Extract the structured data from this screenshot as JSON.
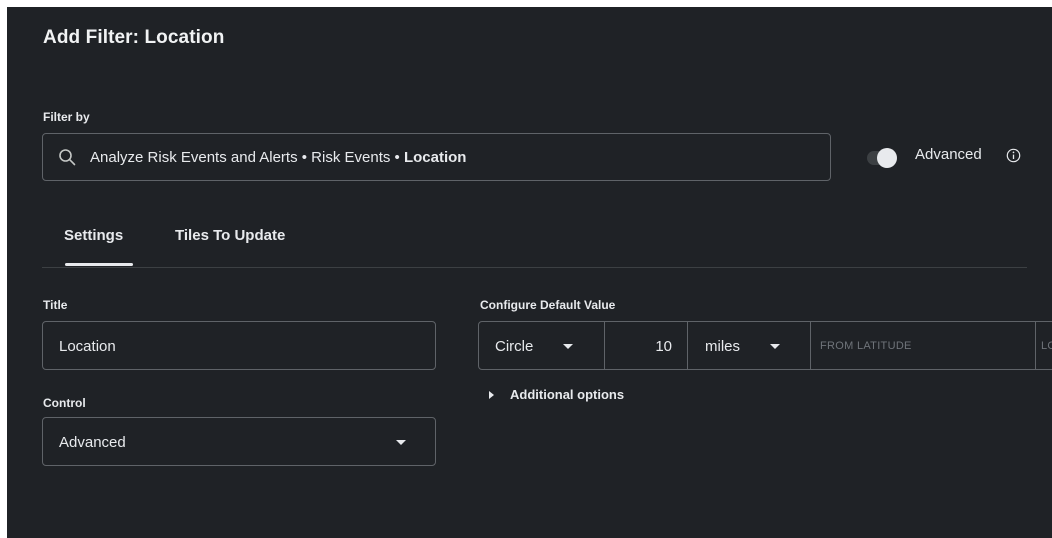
{
  "dialog": {
    "title": "Add Filter: Location"
  },
  "filter_by": {
    "label": "Filter by",
    "path_prefix": "Analyze Risk Events and Alerts • Risk Events • ",
    "path_field": "Location",
    "advanced_toggle_label": "Advanced",
    "advanced_enabled": false
  },
  "tabs": [
    {
      "label": "Settings",
      "active": true
    },
    {
      "label": "Tiles To Update",
      "active": false
    }
  ],
  "settings": {
    "title_label": "Title",
    "title_value": "Location",
    "control_label": "Control",
    "control_value": "Advanced"
  },
  "default_value": {
    "label": "Configure Default Value",
    "shape": "Circle",
    "distance": "10",
    "unit": "miles",
    "from_latitude_placeholder": "FROM LATITUDE",
    "next_placeholder_partial": "LO",
    "additional_options_label": "Additional options"
  },
  "colors": {
    "background": "#1f2226",
    "border": "#5f6368",
    "text": "#e8eaed",
    "placeholder": "#6f747a"
  }
}
